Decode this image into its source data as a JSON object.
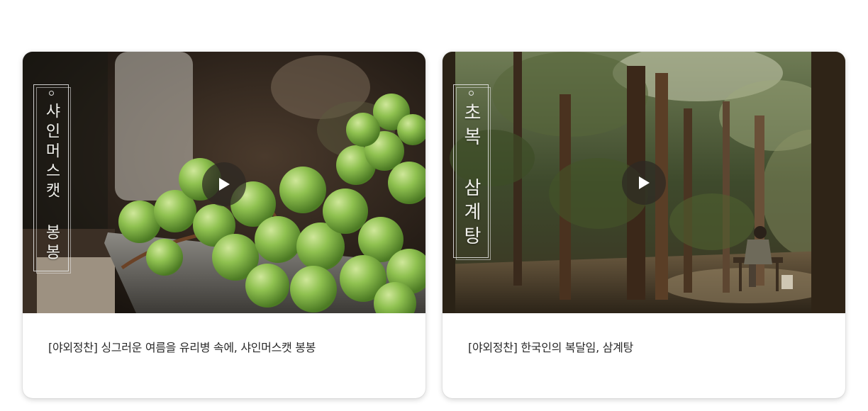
{
  "cards": [
    {
      "title_vertical": "샤인머스캣 봉봉",
      "caption": "[야외정찬] 싱그러운 여름을 유리병 속에, 샤인머스캣 봉봉",
      "play_icon": "play-icon"
    },
    {
      "title_vertical": "초복 삼계탕",
      "caption": "[야외정찬] 한국인의 복달임, 삼계탕",
      "play_icon": "play-icon"
    }
  ]
}
